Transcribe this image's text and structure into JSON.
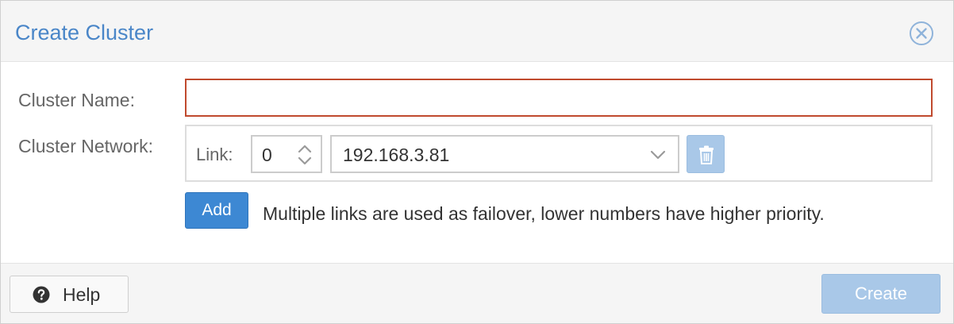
{
  "dialog": {
    "title": "Create Cluster",
    "close_icon": "close-circle-icon"
  },
  "form": {
    "cluster_name_label": "Cluster Name:",
    "cluster_name_value": "",
    "cluster_network_label": "Cluster Network:",
    "links": [
      {
        "link_label": "Link:",
        "number": "0",
        "address": "192.168.3.81",
        "delete_icon": "trash-icon"
      }
    ],
    "add_label": "Add",
    "hint": "Multiple links are used as failover, lower numbers have higher priority."
  },
  "footer": {
    "help_label": "Help",
    "help_icon": "question-circle-icon",
    "create_label": "Create"
  },
  "colors": {
    "title": "#4a86c8",
    "invalid_border": "#c04a2e",
    "primary": "#3d88d3",
    "disabled_primary": "#a9c8e8"
  }
}
